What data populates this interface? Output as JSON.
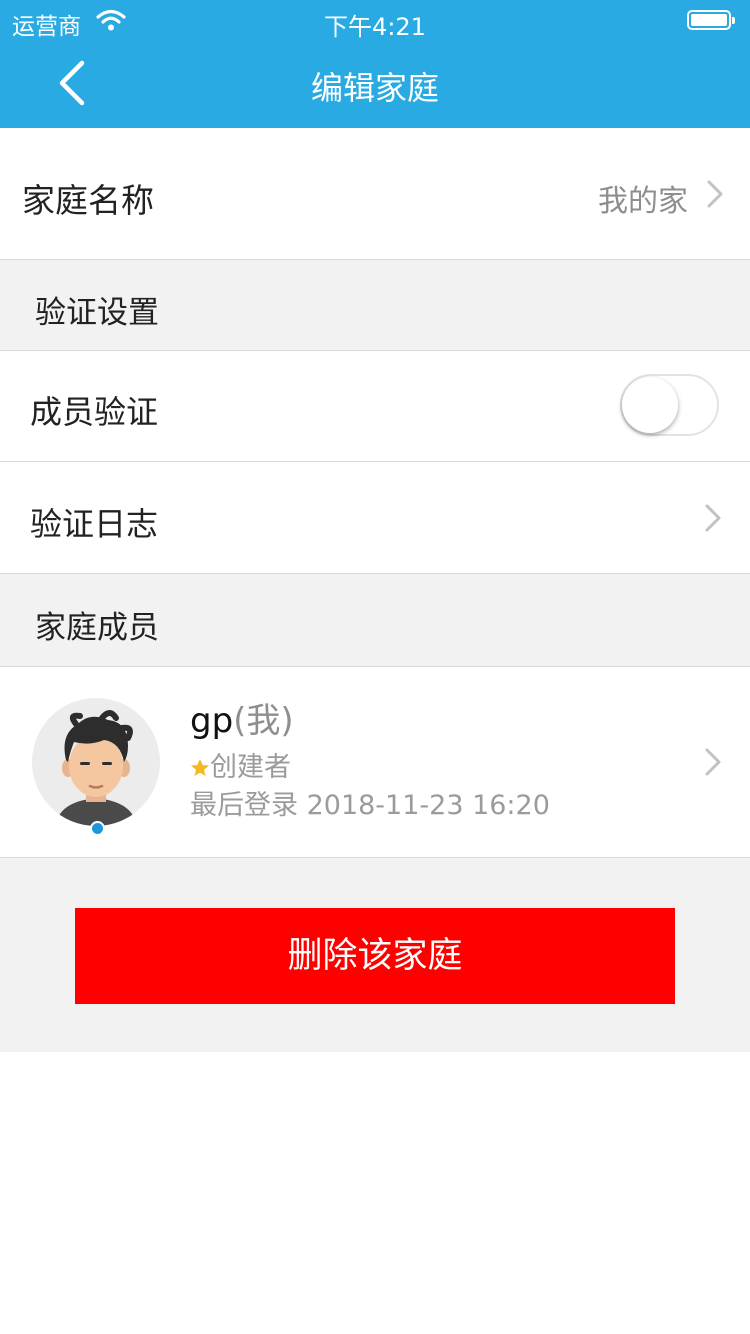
{
  "status_bar": {
    "carrier": "运营商",
    "time": "下午4:21"
  },
  "nav": {
    "title": "编辑家庭",
    "back_icon": "chevron-left-icon"
  },
  "family_name": {
    "label": "家庭名称",
    "value": "我的家"
  },
  "verify_section": {
    "header": "验证设置",
    "member_verify": {
      "label": "成员验证",
      "enabled": false
    },
    "verify_log": {
      "label": "验证日志"
    }
  },
  "members_section": {
    "header": "家庭成员",
    "members": [
      {
        "name": "gp",
        "self_tag": "(我)",
        "role": "创建者",
        "role_icon": "star-icon",
        "last_login": "最后登录 2018-11-23 16:20",
        "online": true
      }
    ]
  },
  "delete_button": "删除该家庭",
  "colors": {
    "header": "#29aae3",
    "danger": "#ff0000",
    "star": "#f5b820"
  }
}
